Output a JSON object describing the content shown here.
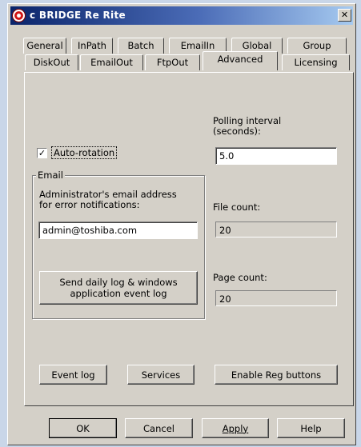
{
  "window": {
    "title": "c BRIDGE Re Rite",
    "close_glyph": "✕"
  },
  "tabs_row1": [
    "General",
    "InPath",
    "Batch",
    "EmailIn",
    "Global",
    "Group"
  ],
  "tabs_row2": [
    "DiskOut",
    "EmailOut",
    "FtpOut",
    "Advanced",
    "Licensing"
  ],
  "active_tab": "Advanced",
  "advanced": {
    "auto_rotation": {
      "label": "Auto-rotation",
      "checked": true,
      "check_glyph": "✓"
    },
    "polling_label_line1": "Polling interval",
    "polling_label_line2": "(seconds):",
    "polling_value": "5.0",
    "email_group": {
      "legend": "Email",
      "admin_label_line1": "Administrator's email address",
      "admin_label_line2": "for error notifications:",
      "admin_value": "admin@toshiba.com",
      "send_log_line1": "Send daily log & windows",
      "send_log_line2": "application event log"
    },
    "file_count_label": "File count:",
    "file_count_value": "20",
    "page_count_label": "Page count:",
    "page_count_value": "20",
    "event_log_button": "Event log",
    "services_button": "Services",
    "enable_reg_button": "Enable Reg buttons"
  },
  "footer": {
    "ok": "OK",
    "cancel": "Cancel",
    "apply": "Apply",
    "help": "Help"
  },
  "colors": {
    "desktop": "#c9d6e8",
    "dialog_face": "#d4d0c8",
    "title_gradient_start": "#0a246a",
    "title_gradient_end": "#a6caf0"
  }
}
